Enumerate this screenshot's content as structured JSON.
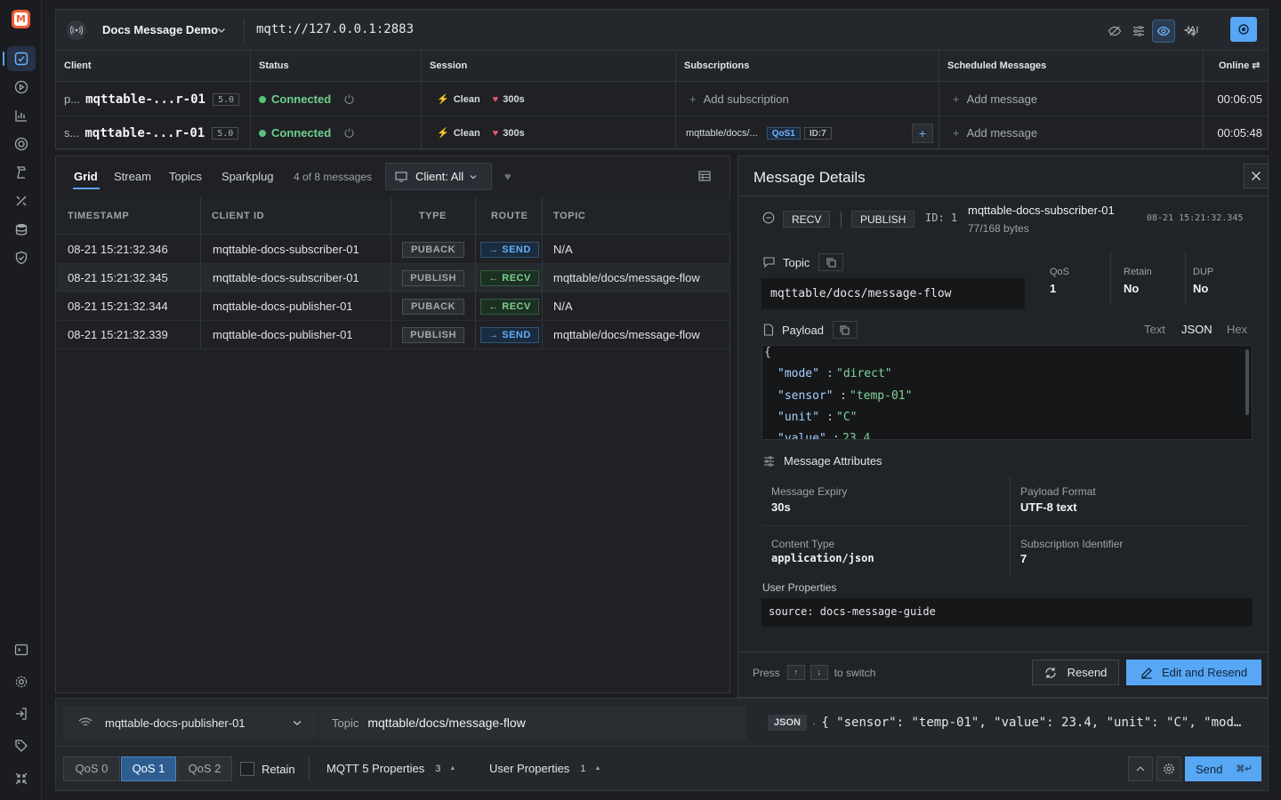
{
  "app": {
    "logo_letter": "M"
  },
  "connection": {
    "name": "Docs Message Demo",
    "url": "mqtt://127.0.0.1:2883",
    "ai_label": "AI"
  },
  "clients_table": {
    "headers": [
      "Client",
      "Status",
      "Session",
      "Subscriptions",
      "Scheduled Messages",
      "Online"
    ],
    "rows": [
      {
        "prefix": "p...",
        "client": "mqttable-...r-01",
        "version": "5.0",
        "status": "Connected",
        "session": "Clean",
        "expiry": "300s",
        "subscription_action": "Add subscription",
        "subscription_topic": "",
        "sub_qos": "",
        "sub_id": "",
        "scheduled": "Add message",
        "online": "00:06:05"
      },
      {
        "prefix": "s...",
        "client": "mqttable-...r-01",
        "version": "5.0",
        "status": "Connected",
        "session": "Clean",
        "expiry": "300s",
        "subscription_action": "",
        "subscription_topic": "mqttable/docs/...",
        "sub_qos": "QoS1",
        "sub_id": "ID:7",
        "scheduled": "Add message",
        "online": "00:05:48"
      }
    ]
  },
  "message_panel": {
    "tabs": [
      "Grid",
      "Stream",
      "Topics",
      "Sparkplug"
    ],
    "active_tab": "Grid",
    "count_text": "4 of 8 messages",
    "client_filter": "Client: All",
    "columns": [
      "TIMESTAMP",
      "CLIENT ID",
      "TYPE",
      "ROUTE",
      "TOPIC"
    ],
    "rows": [
      {
        "timestamp": "08-21 15:21:32.346",
        "client_id": "mqttable-docs-subscriber-01",
        "type": "PUBACK",
        "route": "→ SEND",
        "route_kind": "send",
        "topic": "N/A"
      },
      {
        "timestamp": "08-21 15:21:32.345",
        "client_id": "mqttable-docs-subscriber-01",
        "type": "PUBLISH",
        "route": "← RECV",
        "route_kind": "recv",
        "topic": "mqttable/docs/message-flow"
      },
      {
        "timestamp": "08-21 15:21:32.344",
        "client_id": "mqttable-docs-publisher-01",
        "type": "PUBACK",
        "route": "← RECV",
        "route_kind": "recv",
        "topic": "N/A"
      },
      {
        "timestamp": "08-21 15:21:32.339",
        "client_id": "mqttable-docs-publisher-01",
        "type": "PUBLISH",
        "route": "→ SEND",
        "route_kind": "send",
        "topic": "mqttable/docs/message-flow"
      }
    ]
  },
  "details": {
    "title": "Message Details",
    "direction": "RECV",
    "packet_type": "PUBLISH",
    "packet_id": "ID: 1",
    "client_id": "mqttable-docs-subscriber-01",
    "size": "77/168 bytes",
    "timestamp": "08-21 15:21:32.345",
    "topic_label": "Topic",
    "topic": "mqttable/docs/message-flow",
    "qos_label": "QoS",
    "qos": "1",
    "retain_label": "Retain",
    "retain": "No",
    "dup_label": "DUP",
    "dup": "No",
    "payload_label": "Payload",
    "payload_formats": [
      "Text",
      "JSON",
      "Hex"
    ],
    "active_format": "JSON",
    "payload_lines": [
      {
        "open": "{"
      },
      {
        "key": "\"mode\"",
        "value": "\"direct\""
      },
      {
        "key": "\"sensor\"",
        "value": "\"temp-01\""
      },
      {
        "key": "\"unit\"",
        "value": "\"C\""
      },
      {
        "key": "\"value\"",
        "value": "23.4"
      }
    ],
    "attributes_label": "Message Attributes",
    "attributes": [
      {
        "label": "Message Expiry",
        "value": "30s"
      },
      {
        "label": "Payload Format",
        "value": "UTF-8 text"
      },
      {
        "label": "Content Type",
        "value": "application/json"
      },
      {
        "label": "Subscription Identifier",
        "value": "7"
      }
    ],
    "user_properties_label": "User Properties",
    "user_properties": "source: docs-message-guide",
    "switch_press": "Press",
    "switch_up": "↑",
    "switch_down": "↓",
    "switch_text": "to switch",
    "resend": "Resend",
    "edit_resend": "Edit and Resend"
  },
  "publish": {
    "client": "mqttable-docs-publisher-01",
    "topic_label": "Topic",
    "topic": "mqttable/docs/message-flow",
    "payload_format": "JSON",
    "payload_preview": "{ \"sensor\": \"temp-01\", \"value\": 23.4, \"unit\": \"C\", \"mod…",
    "qos_options": [
      "QoS 0",
      "QoS 1",
      "QoS 2"
    ],
    "qos_selected": "QoS 1",
    "retain_label": "Retain",
    "mqtt5_label": "MQTT 5 Properties",
    "mqtt5_count": "3",
    "user_props_label": "User Properties",
    "user_props_count": "1",
    "send": "Send",
    "send_shortcut": "⌘↵"
  },
  "colors": {
    "accent": "#57a7f4",
    "connected": "#6fd08d",
    "heart": "#e45a6a",
    "logo": "#ec5d35"
  }
}
